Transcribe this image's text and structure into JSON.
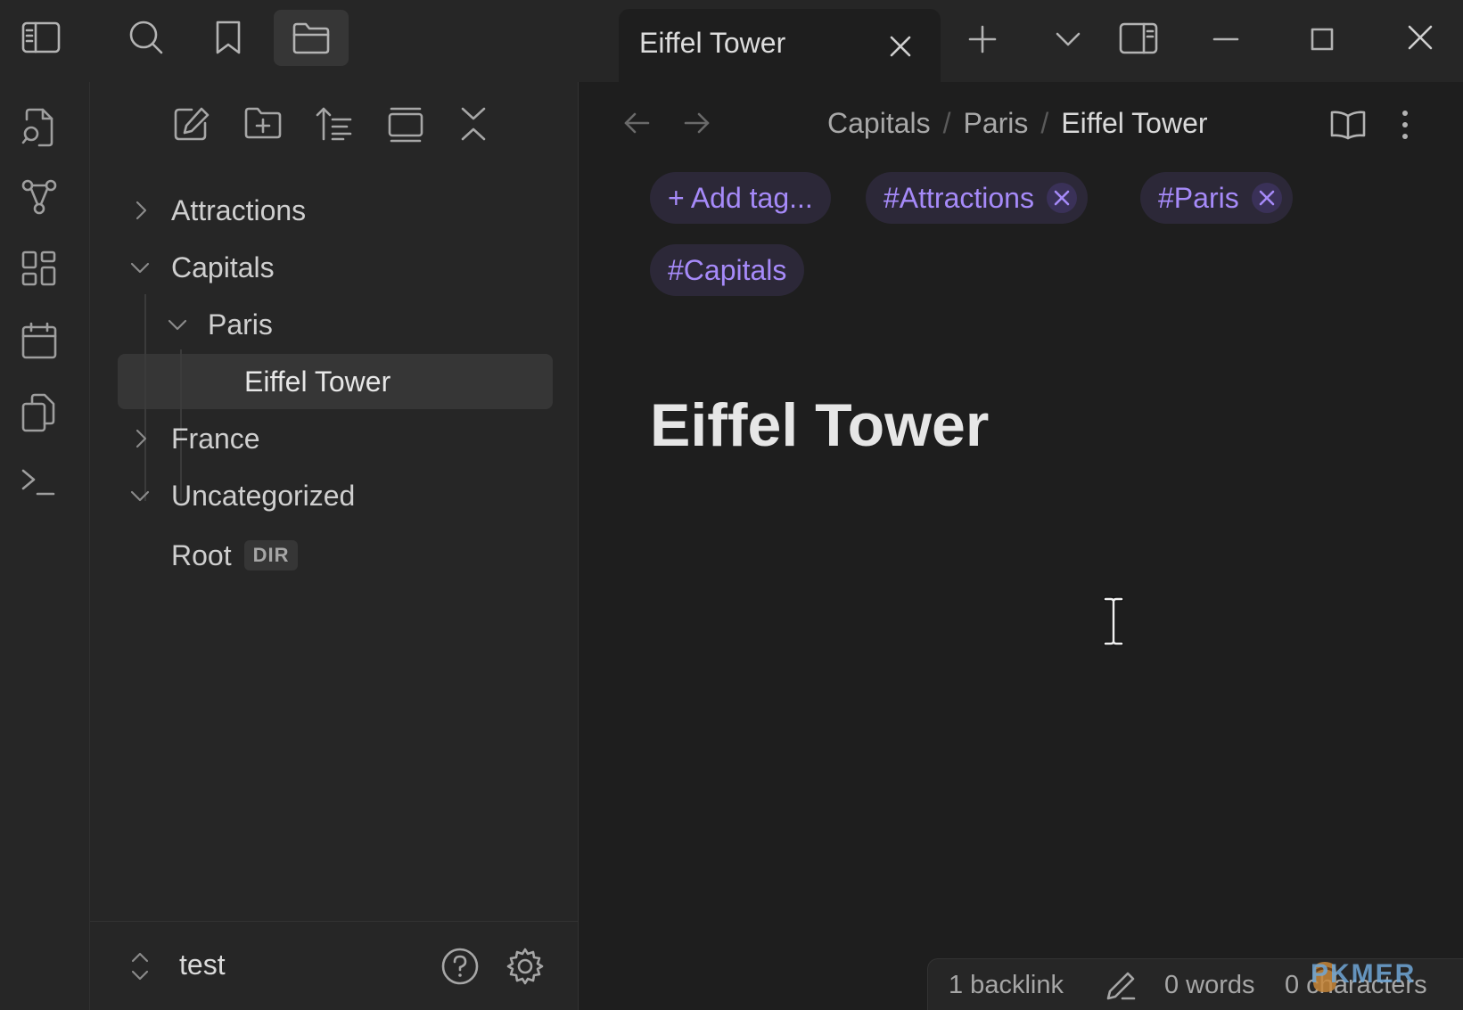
{
  "tab": {
    "title": "Eiffel Tower"
  },
  "sidebar": {
    "tree": [
      {
        "label": "Attractions",
        "state": "collapsed"
      },
      {
        "label": "Capitals",
        "state": "expanded"
      },
      {
        "label": "Paris",
        "state": "expanded"
      },
      {
        "label": "Eiffel Tower",
        "state": "selected"
      },
      {
        "label": "France",
        "state": "collapsed"
      },
      {
        "label": "Uncategorized",
        "state": "expanded"
      },
      {
        "label": "Root",
        "badge": "DIR"
      }
    ],
    "vault_name": "test"
  },
  "main": {
    "breadcrumb": [
      "Capitals",
      "Paris",
      "Eiffel Tower"
    ],
    "breadcrumb_separator": "/",
    "tags": {
      "add_label": "+ Add tag...",
      "items": [
        "#Attractions",
        "#Paris",
        "#Capitals"
      ]
    },
    "note_title": "Eiffel Tower"
  },
  "statusbar": {
    "backlinks": "1 backlink",
    "words": "0 words",
    "characters": "0 characters"
  },
  "watermark": "PKMER",
  "colors": {
    "accent": "#a68af9",
    "tag_bg": "#2c2838",
    "background": "#1e1e1e",
    "panel": "#262626"
  }
}
